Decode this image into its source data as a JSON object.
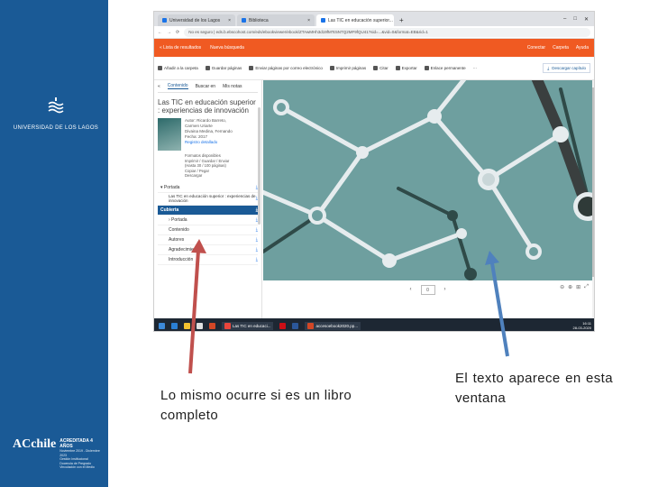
{
  "brand": {
    "band_color": "#1a5a96",
    "university_name": "UNIVERSIDAD DE LOS LAGOS",
    "accreditation_title": "ACREDITADA 4 AÑOS",
    "accreditation_lines": [
      "Noviembre 2019 - Diciembre 2023",
      "Gestión Institucional",
      "Docencia de Pregrado",
      "Vinculación con el Medio"
    ],
    "accreditation_mark": "ACchile"
  },
  "browser": {
    "tabs": [
      {
        "label": "Universidad de los Lagos",
        "active": false
      },
      {
        "label": "Biblioteca",
        "active": false
      },
      {
        "label": "Las TIC en educación superior...",
        "active": true
      }
    ],
    "new_tab": "+",
    "window_controls": [
      "–",
      "□",
      "✕"
    ],
    "nav": [
      "←",
      "→",
      "⟳"
    ],
    "url": "No es seguro | eds.b.ebscohost.com/eds/ebookviewer/ebook/ZTAwMHh3d19fMTc5NTQ2MF9fQU41?sid=...&vid=0&format=EB&rid=1",
    "orange_bar": {
      "color": "#f05a22",
      "left": [
        "« Lista de resultados",
        "Nueva búsqueda"
      ],
      "right": [
        "Conectar",
        "Carpeta",
        "Ayuda"
      ]
    },
    "toolbar": {
      "items": [
        "Añadir a la carpeta",
        "Guardar páginas",
        "Enviar páginas por correo electrónico",
        "Imprimir páginas",
        "Citar",
        "Exportar",
        "Enlace permanente",
        "···"
      ],
      "download_label": "Descargar capítulo"
    }
  },
  "ebook": {
    "sidebar_tabs": [
      "Contenido",
      "Buscar en",
      "Mis notas"
    ],
    "collapse": "«",
    "title": "Las TIC en educación superior : experiencias de innovación",
    "meta": [
      "Autor: Ricardo Barreto,",
      "Carmen Uriarte",
      "Divaina Medina, Fernando",
      "Fecha: 2017"
    ],
    "meta_link": "Registro detallado",
    "formats": [
      "Formatos disponibles",
      "Imprimir / Guardar / Enviar",
      "(Hasta 30 / 100 páginas)",
      "Copiar / Pegar",
      "Descargar"
    ],
    "toc": [
      {
        "label": "▾ Portada",
        "active": false
      },
      {
        "label": "Las TIC en educación superior : experiencias de innovación",
        "active": false
      },
      {
        "label": "Cubierta",
        "active": true
      },
      {
        "label": "› Portada",
        "active": false
      },
      {
        "label": "Contenido",
        "active": false
      },
      {
        "label": "Autores",
        "active": false
      },
      {
        "label": "Agradecimientos",
        "active": false
      },
      {
        "label": "Introducción",
        "active": false
      }
    ],
    "download_icon": "⤓",
    "pager": {
      "prev": "‹",
      "page": "0",
      "next": "›"
    },
    "zoom": [
      "⊖",
      "⊕",
      "⊞",
      "⤢"
    ],
    "viewer_bg": "#6e9f9f"
  },
  "taskbar": {
    "items": [
      "Las TIC en educaci...",
      "accesoebook2020.pp..."
    ],
    "time": "16:11",
    "date": "28-03-2020"
  },
  "captions": {
    "left": "Lo mismo ocurre si es un libro completo",
    "right": "El texto aparece en esta ventana"
  },
  "arrows": {
    "left_color": "#c0504d",
    "right_color": "#4f81bd"
  }
}
